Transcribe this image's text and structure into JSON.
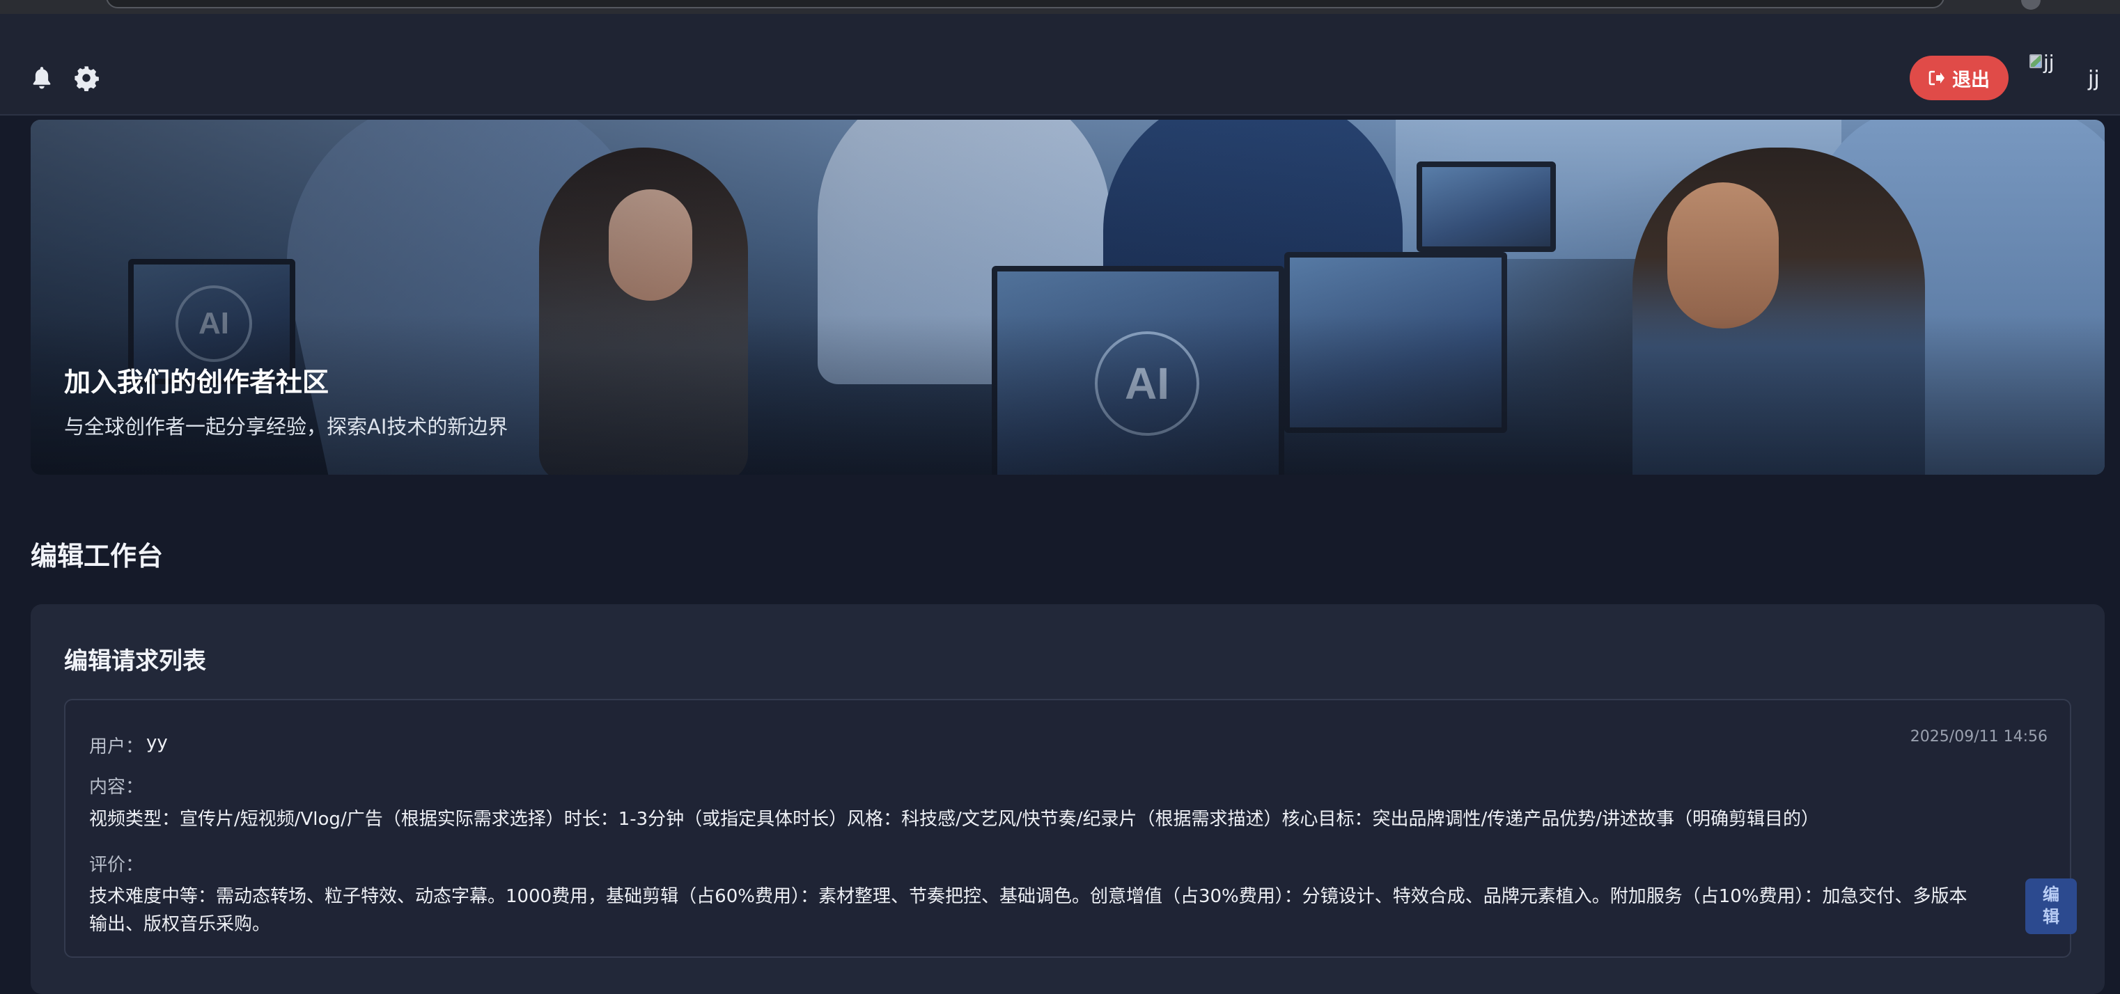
{
  "header": {
    "logout_label": "退出",
    "avatar_alt": "jj",
    "username": "jj",
    "logout_color": "#e04b48"
  },
  "hero": {
    "title": "加入我们的创作者社区",
    "subtitle": "与全球创作者一起分享经验，探索AI技术的新边界",
    "screen_mark": "AI"
  },
  "workspace": {
    "title": "编辑工作台",
    "panel_title": "编辑请求列表",
    "requests": [
      {
        "user_label": "用户：",
        "user": "yy",
        "date": "2025/09/11 14:56",
        "content_label": "内容：",
        "content": "视频类型：宣传片/短视频/Vlog/广告（根据实际需求选择）时长：1-3分钟（或指定具体时长）风格：科技感/文艺风/快节奏/纪录片（根据需求描述）核心目标：突出品牌调性/传递产品优势/讲述故事（明确剪辑目的）",
        "eval_label": "评价：",
        "evaluation": "技术难度中等：需动态转场、粒子特效、动态字幕。1000费用，基础剪辑（占60%费用）：素材整理、节奏把控、基础调色。创意增值（占30%费用）：分镜设计、特效合成、品牌元素植入。附加服务（占10%费用）：加急交付、多版本输出、版权音乐采购。",
        "edit_label": "编辑"
      }
    ]
  },
  "icons": {
    "bell": "bell-icon",
    "gear": "gear-icon",
    "logout": "sign-out-icon"
  }
}
